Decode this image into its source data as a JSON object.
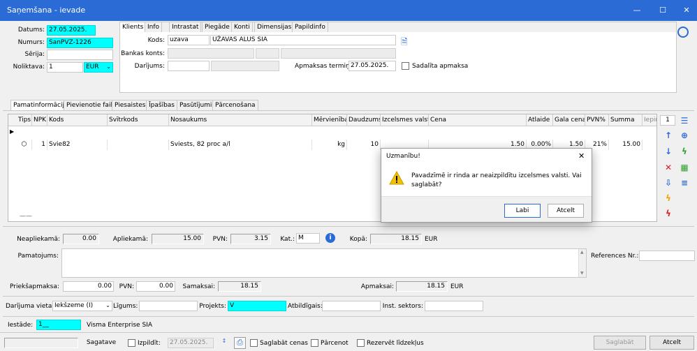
{
  "window": {
    "title": "Saņemšana - ievade",
    "minimize": "—",
    "maximize": "☐",
    "close": "✕"
  },
  "header": {
    "datums_label": "Datums:",
    "datums_value": "27.05.2025.",
    "numurs_label": "Numurs:",
    "numurs_value": "SanPVZ-1226",
    "serija_label": "Sērija:",
    "serija_value": "",
    "noliktava_label": "Noliktava:",
    "noliktava_value": "1",
    "currency_value": "EUR"
  },
  "client_tabs": [
    "Klients",
    "Info",
    "Intrastat",
    "Piegāde",
    "Konti",
    "Dimensijas",
    "Papildinfo"
  ],
  "client": {
    "kods_label": "Kods:",
    "kods_value": "uzava",
    "name_value": "UŽAVAS ALUS SIA",
    "bankas_konts_label": "Bankas konts:",
    "darijums_label": "Darījums:",
    "apmaksas_termins_label": "Apmaksas termiņš:",
    "apmaksas_termins_value": "27.05.2025.",
    "sadalita_apmaksa_label": "Sadalīta apmaksa"
  },
  "main_tabs": [
    "Pamatinformācija",
    "Pievienotie faili",
    "Piesaistes",
    "Īpašības",
    "Pasūtījumi",
    "Pārcenošana"
  ],
  "grid": {
    "headers": [
      "Tips",
      "NPK",
      "Kods",
      "Svītrkods",
      "Nosaukums",
      "Mērvienība",
      "Daudzums",
      "Izcelsmes valsts",
      "Cena",
      "Atlaide",
      "Gala cena",
      "PVN%",
      "Summa",
      "Iepir"
    ],
    "rows": [
      [
        "",
        "1",
        "Svie82",
        "",
        "Sviests, 82 proc a/l",
        "kg",
        "10",
        "",
        "1.50",
        "0.00%",
        "1.50",
        "21%",
        "15.00",
        ""
      ]
    ],
    "footer_marker": "——"
  },
  "side_counter": "1",
  "totals": {
    "neapliekama_label": "Neapliekamā:",
    "neapliekama_value": "0.00",
    "apliekama_label": "Apliekamā:",
    "apliekama_value": "15.00",
    "pvn_label": "PVN:",
    "pvn_value": "3.15",
    "kat_label": "Kat.:",
    "kat_value": "M",
    "kopa_label": "Kopā:",
    "kopa_value": "18.15",
    "kopa_currency": "EUR"
  },
  "pamatojums_label": "Pamatojums:",
  "references_label": "References Nr.:",
  "payments": {
    "priekssapmaksa_label": "Priekšapmaksa:",
    "priekssapmaksa_value": "0.00",
    "pvn_label": "PVN:",
    "pvn_value": "0.00",
    "samaksai_label": "Samaksai:",
    "samaksai_value": "18.15",
    "apmaksai_label": "Apmaksai:",
    "apmaksai_value": "18.15",
    "apmaksai_currency": "EUR"
  },
  "deal": {
    "darijuma_vieta_label": "Darījuma vieta:",
    "darijuma_vieta_value": "Iekšzeme (I)",
    "ligums_label": "Līgums:",
    "projekts_label": "Projekts:",
    "projekts_value": "V",
    "atbildigais_label": "Atbildīgais:",
    "inst_sektors_label": "Inst. sektors:"
  },
  "iestade": {
    "label": "Iestāde:",
    "value": "1__",
    "name": "Visma Enterprise SIA"
  },
  "bottom": {
    "sagatave": "Sagatave",
    "izpildit_label": "Izpildīt:",
    "izpildit_date": "27.05.2025.",
    "saglabat_cenas": "Saglabāt cenas",
    "parcenot": "Pārcenot",
    "rezervet": "Rezervēt līdzekļus",
    "saglabat_btn": "Saglabāt",
    "atcelt_btn": "Atcelt"
  },
  "dialog": {
    "title": "Uzmanību!",
    "message_line1": "Pavadzīmē ir rinda ar neaizpildītu izcelsmes valsti. Vai",
    "message_line2": "saglabāt?",
    "ok": "Labi",
    "cancel": "Atcelt"
  },
  "colors": {
    "titlebar": "#2b6bd6",
    "highlight": "#00ffff",
    "warning": "#f2c200"
  },
  "icons": [
    "refresh-icon",
    "info-icon",
    "expand-icon",
    "arrow-up-icon",
    "arrow-down-icon",
    "delete-icon",
    "lightning-icon",
    "calculator-icon",
    "print-icon",
    "chat-icon",
    "warning-icon"
  ]
}
